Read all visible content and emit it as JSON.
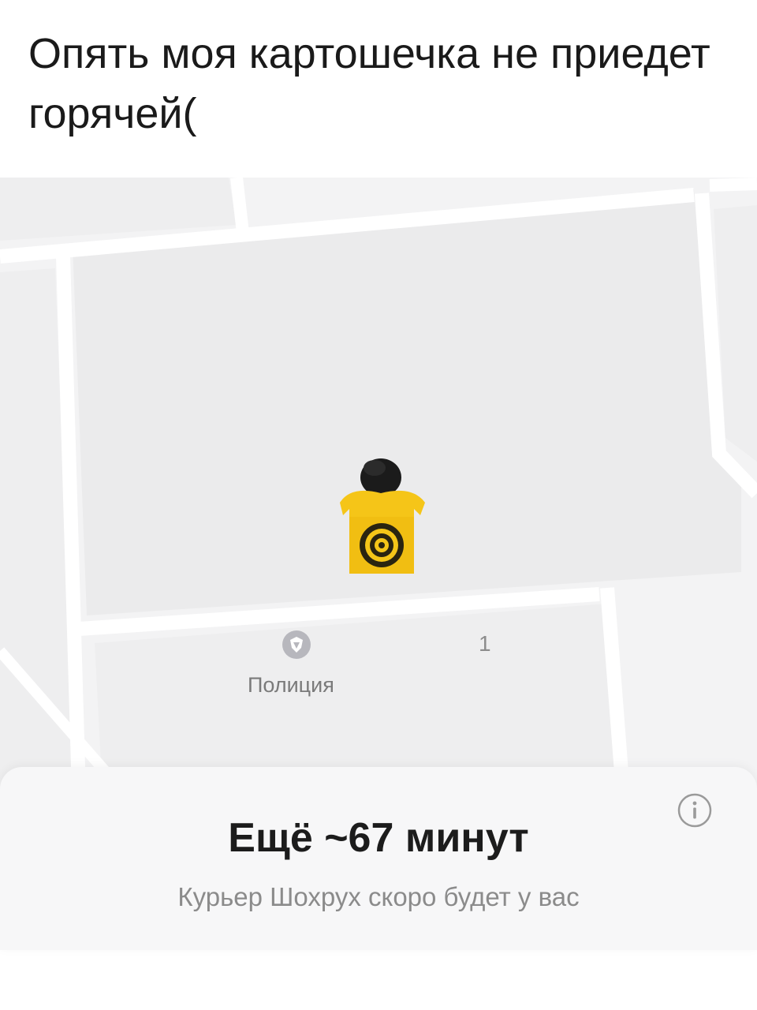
{
  "caption": "Опять моя картошечка не приедет горячей(",
  "map": {
    "poi_police_label": "Полиция",
    "house_number": "1",
    "courier_marker_icon": "courier-spiral-marker-icon",
    "poi_police_icon": "police-badge-icon",
    "gym_icon": "dumbbell-icon",
    "locate_icon": "crosshair-icon",
    "colors": {
      "background": "#f3f3f4",
      "block": "#ebebec",
      "road": "#ffffff",
      "marker_yellow": "#f5c518",
      "gym_purple": "#9a8be0"
    }
  },
  "sheet": {
    "eta_title": "Ещё ~67 минут",
    "eta_subtitle": "Курьер Шохрух скоро будет у вас",
    "info_icon": "info-icon"
  }
}
